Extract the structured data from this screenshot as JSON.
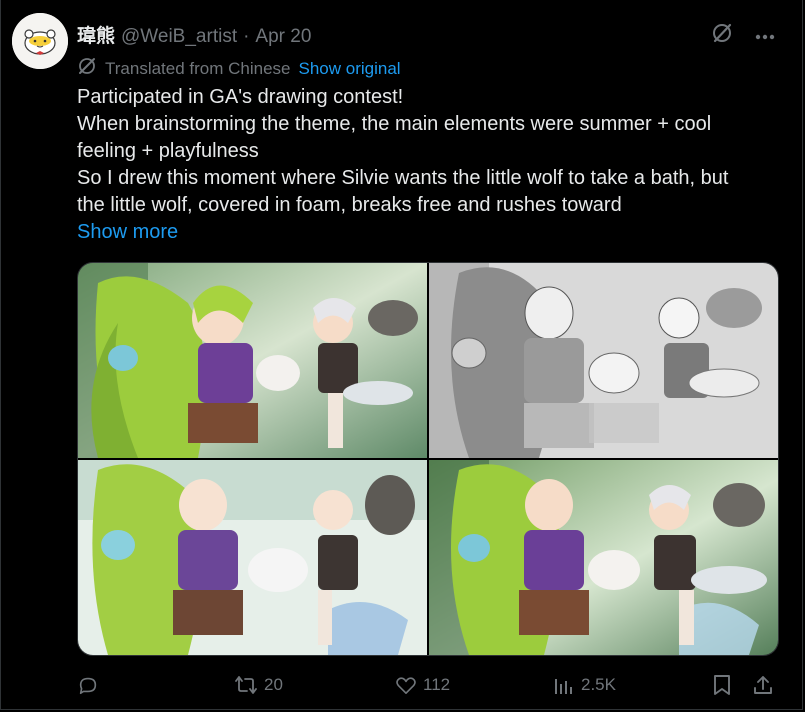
{
  "post": {
    "display_name": "瑋熊",
    "handle": "@WeiB_artist",
    "separator": "·",
    "date": "Apr 20",
    "translated_label": "Translated from Chinese",
    "show_original": "Show original",
    "text_lines": [
      "Participated in GA's drawing contest!",
      "When brainstorming the theme, the main elements were summer + cool",
      "feeling + playfulness",
      "So I drew this moment where Silvie wants the little wolf to take a bath, but",
      "the little wolf, covered in foam, breaks free and rushes toward"
    ],
    "show_more": "Show more"
  },
  "actions": {
    "reply_count": "",
    "repost_count": "20",
    "like_count": "112",
    "views_count": "2.5K"
  },
  "colors": {
    "background": "#000000",
    "text": "#e7e9ea",
    "muted": "#71767b",
    "link": "#1d9bf0",
    "border": "#2f3336"
  },
  "icons": [
    "grok-icon",
    "more-icon",
    "translate-icon",
    "reply-icon",
    "repost-icon",
    "like-icon",
    "views-icon",
    "bookmark-icon",
    "share-icon"
  ]
}
